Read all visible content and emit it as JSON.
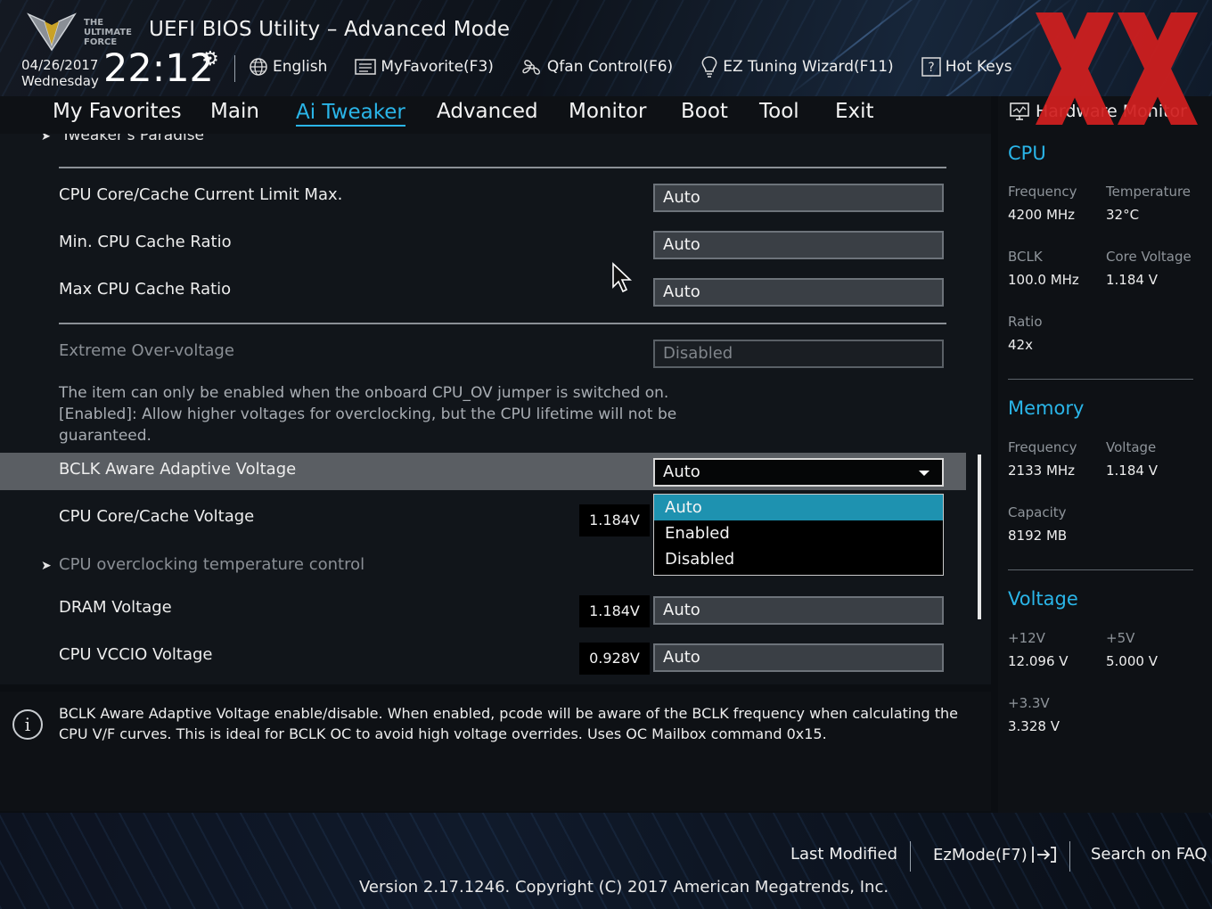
{
  "header": {
    "title": "UEFI BIOS Utility – Advanced Mode",
    "date": "04/26/2017",
    "day": "Wednesday",
    "time": "22:12",
    "logo_text": "THE ULTIMATE FORCE",
    "toolbar": [
      {
        "label": "English",
        "icon": "globe-icon"
      },
      {
        "label": "MyFavorite(F3)",
        "icon": "favorite-list-icon"
      },
      {
        "label": "Qfan Control(F6)",
        "icon": "fan-icon"
      },
      {
        "label": "EZ Tuning Wizard(F11)",
        "icon": "lightbulb-icon"
      },
      {
        "label": "Hot Keys",
        "icon": "help-question-icon"
      }
    ]
  },
  "menu": {
    "items": [
      "My Favorites",
      "Main",
      "Ai Tweaker",
      "Advanced",
      "Monitor",
      "Boot",
      "Tool",
      "Exit"
    ],
    "active": "Ai Tweaker"
  },
  "main": {
    "breadcrumb": "Tweaker's Paradise",
    "settings": [
      {
        "label": "CPU Core/Cache Current Limit Max.",
        "value": "Auto"
      },
      {
        "label": "Min. CPU Cache Ratio",
        "value": "Auto"
      },
      {
        "label": "Max CPU Cache Ratio",
        "value": "Auto"
      },
      {
        "label": "Extreme Over-voltage",
        "value": "Disabled"
      },
      {
        "label": "BCLK Aware Adaptive Voltage",
        "value": "Auto"
      },
      {
        "label": "CPU Core/Cache Voltage",
        "reading": "1.184V"
      },
      {
        "label": "CPU overclocking temperature control"
      },
      {
        "label": "DRAM Voltage",
        "reading": "1.184V",
        "value": "Auto"
      },
      {
        "label": "CPU VCCIO Voltage",
        "reading": "0.928V",
        "value": "Auto"
      }
    ],
    "help_lines": [
      "The item can only be enabled when the onboard CPU_OV jumper is switched on.",
      "[Enabled]: Allow higher voltages for overclocking, but the CPU lifetime will not be",
      "guaranteed."
    ],
    "dropdown": {
      "options": [
        "Auto",
        "Enabled",
        "Disabled"
      ],
      "selected": "Auto"
    }
  },
  "info": {
    "text": "BCLK Aware Adaptive Voltage enable/disable. When enabled, pcode will be aware of the BCLK frequency when calculating the CPU V/F curves. This is ideal for BCLK OC to avoid high voltage overrides. Uses OC Mailbox command 0x15."
  },
  "hardware_monitor": {
    "title": "Hardware Monitor",
    "cpu": {
      "heading": "CPU",
      "frequency_label": "Frequency",
      "frequency": "4200 MHz",
      "temperature_label": "Temperature",
      "temperature": "32°C",
      "bclk_label": "BCLK",
      "bclk": "100.0 MHz",
      "core_voltage_label": "Core Voltage",
      "core_voltage": "1.184 V",
      "ratio_label": "Ratio",
      "ratio": "42x"
    },
    "memory": {
      "heading": "Memory",
      "frequency_label": "Frequency",
      "frequency": "2133 MHz",
      "voltage_label": "Voltage",
      "voltage": "1.184 V",
      "capacity_label": "Capacity",
      "capacity": "8192 MB"
    },
    "voltage": {
      "heading": "Voltage",
      "v12_label": "+12V",
      "v12": "12.096 V",
      "v5_label": "+5V",
      "v5": "5.000 V",
      "v33_label": "+3.3V",
      "v33": "3.328 V"
    }
  },
  "footer": {
    "last_modified": "Last Modified",
    "ezmode": "EzMode(F7)",
    "search_faq": "Search on FAQ",
    "version": "Version 2.17.1246. Copyright (C) 2017 American Megatrends, Inc."
  },
  "colors": {
    "accent": "#2ab5e8",
    "selected_option": "#1e92b0",
    "highlight_row": "#5a5e63",
    "watermark": "#d11f1f"
  }
}
